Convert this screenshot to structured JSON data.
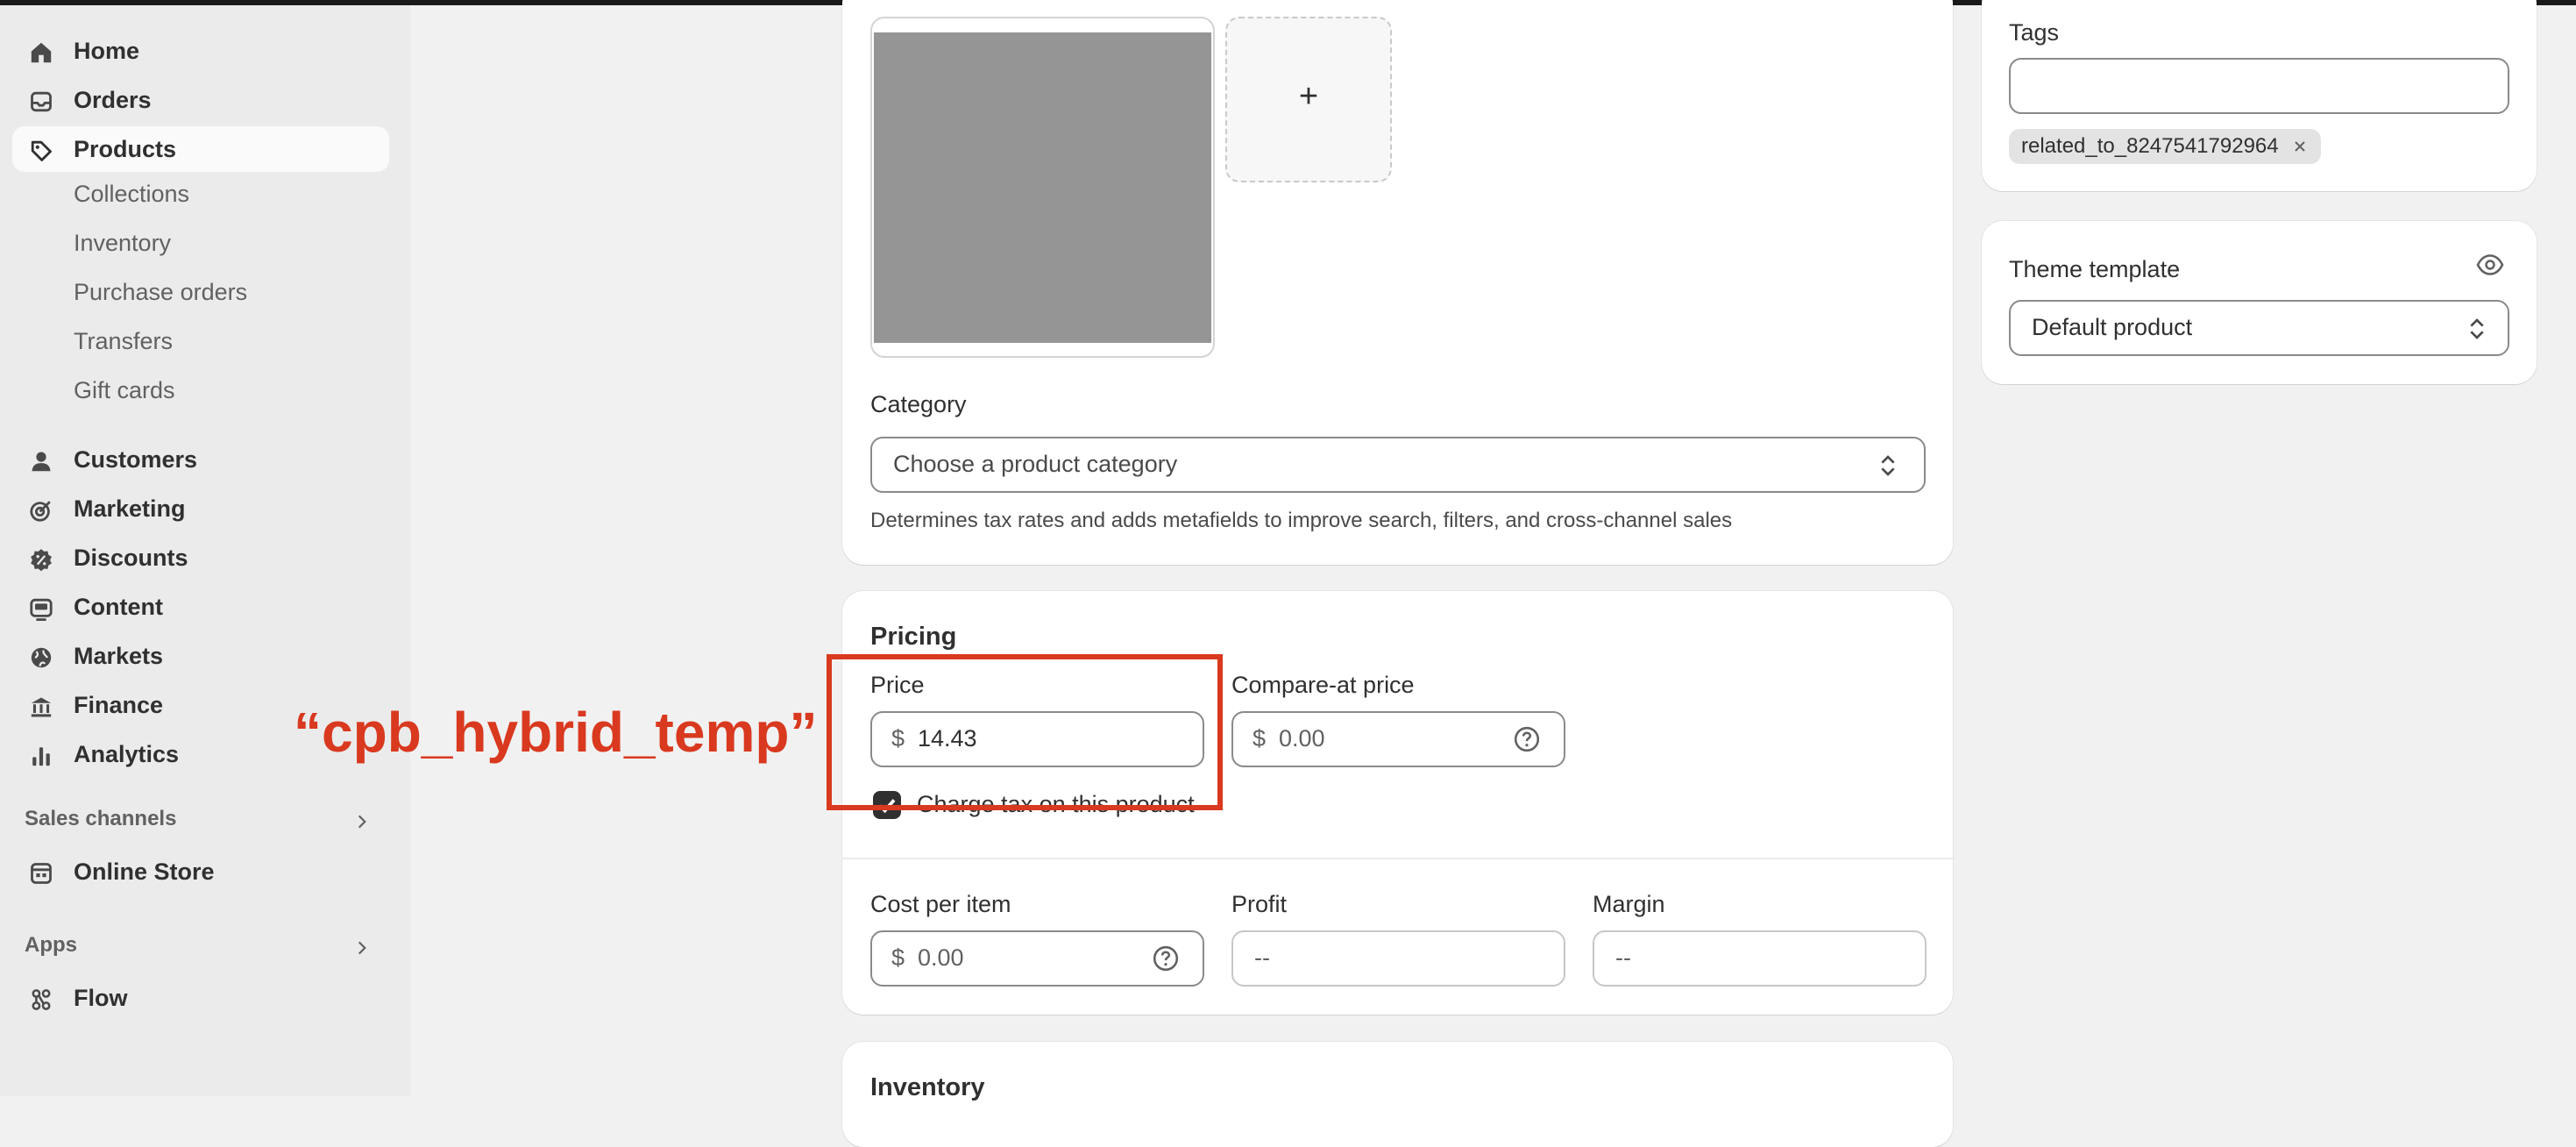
{
  "sidebar": {
    "items": [
      {
        "label": "Home",
        "icon": "home-icon"
      },
      {
        "label": "Orders",
        "icon": "inbox-icon"
      },
      {
        "label": "Products",
        "icon": "tag-icon",
        "active": true
      }
    ],
    "product_sub_items": [
      "Collections",
      "Inventory",
      "Purchase orders",
      "Transfers",
      "Gift cards"
    ],
    "items2": [
      {
        "label": "Customers",
        "icon": "person-icon"
      },
      {
        "label": "Marketing",
        "icon": "target-icon"
      },
      {
        "label": "Discounts",
        "icon": "discount-icon"
      },
      {
        "label": "Content",
        "icon": "image-icon"
      },
      {
        "label": "Markets",
        "icon": "globe-icon"
      },
      {
        "label": "Finance",
        "icon": "bank-icon"
      },
      {
        "label": "Analytics",
        "icon": "bar-chart-icon"
      }
    ],
    "sales_channels": {
      "title": "Sales channels",
      "items": [
        {
          "label": "Online Store",
          "icon": "store-icon"
        }
      ]
    },
    "apps": {
      "title": "Apps",
      "items": [
        {
          "label": "Flow",
          "icon": "flow-icon"
        }
      ]
    }
  },
  "media": {
    "add_label": "+"
  },
  "category": {
    "label": "Category",
    "placeholder": "Choose a product category",
    "help": "Determines tax rates and adds metafields to improve search, filters, and cross-channel sales"
  },
  "pricing": {
    "title": "Pricing",
    "price_label": "Price",
    "price_currency": "$",
    "price_value": "14.43",
    "compare_label": "Compare-at price",
    "compare_currency": "$",
    "compare_value": "0.00",
    "charge_tax_label": "Charge tax on this product",
    "charge_tax_checked": true,
    "cost_label": "Cost per item",
    "cost_currency": "$",
    "cost_value": "0.00",
    "profit_label": "Profit",
    "profit_value": "--",
    "margin_label": "Margin",
    "margin_value": "--"
  },
  "inventory": {
    "title": "Inventory"
  },
  "tags": {
    "label": "Tags",
    "value": "",
    "chips": [
      "related_to_8247541792964"
    ]
  },
  "theme_template": {
    "label": "Theme template",
    "value": "Default product"
  },
  "annotation": {
    "text": "“cpb_hybrid_temp”",
    "color": "#d9391f"
  }
}
